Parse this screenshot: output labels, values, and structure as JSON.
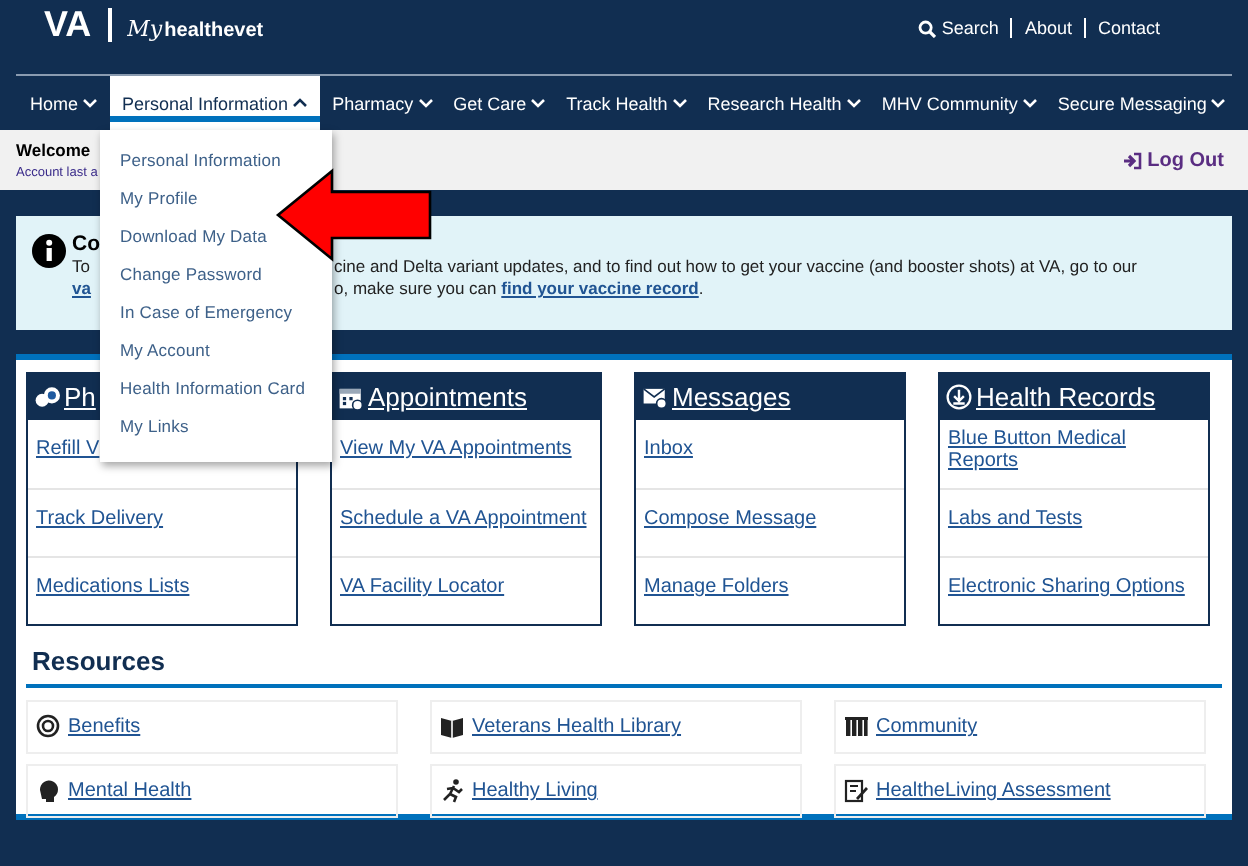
{
  "header": {
    "logo": "VA",
    "brand_script": "My",
    "brand": "healthevet",
    "links": [
      "Search",
      "About",
      "Contact"
    ]
  },
  "nav": [
    {
      "label": "Home",
      "expanded": false
    },
    {
      "label": "Personal Information",
      "expanded": true
    },
    {
      "label": "Pharmacy",
      "expanded": false
    },
    {
      "label": "Get Care",
      "expanded": false
    },
    {
      "label": "Track Health",
      "expanded": false
    },
    {
      "label": "Research Health",
      "expanded": false
    },
    {
      "label": "MHV Community",
      "expanded": false
    },
    {
      "label": "Secure Messaging",
      "expanded": false
    }
  ],
  "dropdown": [
    "Personal Information",
    "My Profile",
    "Download My Data",
    "Change Password",
    "In Case of Emergency",
    "My Account",
    "Health Information Card",
    "My Links"
  ],
  "welcome": {
    "title": "Welcome",
    "subtitle": "Account last a",
    "logout": "Log Out"
  },
  "alert": {
    "title": "Co",
    "line_1_left": "To",
    "line_1_right": "cine and Delta variant updates, and to find out how to get your vaccine (and booster shots) at VA, go to our",
    "line_2_link": "va",
    "line_2_text": "o, make sure you can ",
    "line_2_record_link": "find your vaccine record",
    "line_2_end": "."
  },
  "cards": [
    {
      "title": "Ph",
      "links": [
        "Refill V",
        "Track Delivery",
        "Medications Lists"
      ]
    },
    {
      "title": "Appointments",
      "links": [
        "View My VA Appointments",
        "Schedule a VA Appointment",
        "VA Facility Locator"
      ]
    },
    {
      "title": "Messages",
      "links": [
        "Inbox",
        "Compose Message",
        "Manage Folders"
      ]
    },
    {
      "title": "Health Records",
      "links": [
        "Blue Button Medical Reports",
        "Labs and Tests",
        "Electronic Sharing Options"
      ]
    }
  ],
  "resources": {
    "title": "Resources",
    "items": [
      "Benefits",
      "Veterans Health Library",
      "Community",
      "Mental Health",
      "Healthy Living",
      "HealtheLiving Assessment"
    ]
  }
}
